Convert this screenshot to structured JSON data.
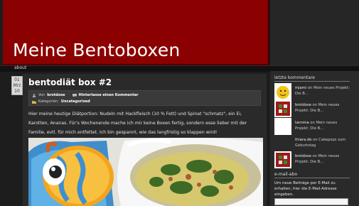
{
  "header": {
    "title": "Meine Bentoboxen"
  },
  "nav": {
    "items": [
      {
        "label": "about"
      }
    ]
  },
  "post": {
    "date": {
      "day": "01",
      "month": "Mrz",
      "year": "10"
    },
    "title": "bentodiät box #2",
    "meta": {
      "by_prefix": "Von",
      "author": "brotdose",
      "comment_link": "Hinterlasse einen Kommentar",
      "categories_prefix": "Kategorien:",
      "category": "Uncategorized"
    },
    "body": "Hier meine heutige Diätportion: Nudeln mit Hackfleisch (10 % Fett) und Spinat \"schmatz\", ein Ei, Karotten, Ananas. Für's Wochenende mache ich mir keine Boxen fertig, sondern esse lieber mit der Familie, evtl. für mich entfettet. Ich bin gespannt, wie das langfristig so klappen wird!"
  },
  "sidebar": {
    "comments_heading": "letzte kommentare",
    "comments": [
      {
        "author": "mjami",
        "on": "on",
        "post": "Mein neues Projekt: Die B…",
        "avatar": "smiley-avatar-icon"
      },
      {
        "author": "brotdose",
        "on": "on",
        "post": "Mein neues Projekt: Die B…",
        "avatar": "red-pattern-avatar-icon"
      },
      {
        "author": "tannina",
        "on": "on",
        "post": "Mein neues Projekt: Die B…",
        "avatar": "blank-avatar-icon"
      },
      {
        "author": "thiara.de",
        "on": "on",
        "post": "Cakepops zum Geburtstag",
        "avatar": ""
      },
      {
        "author": "brotdose",
        "on": "on",
        "post": "Mein neues Projekt: Die B…",
        "avatar": "red-pattern-avatar-icon"
      }
    ],
    "email_heading": "e-mail-abo",
    "email_text": "Um neue Beiträge per E-Mail zu erhalten, hier die E-Mail-Adresse eingeben.",
    "email_placeholder": ""
  },
  "colors": {
    "header_red": "#8b0000",
    "background": "#1d1d1d",
    "content": "#2a2a2a"
  }
}
